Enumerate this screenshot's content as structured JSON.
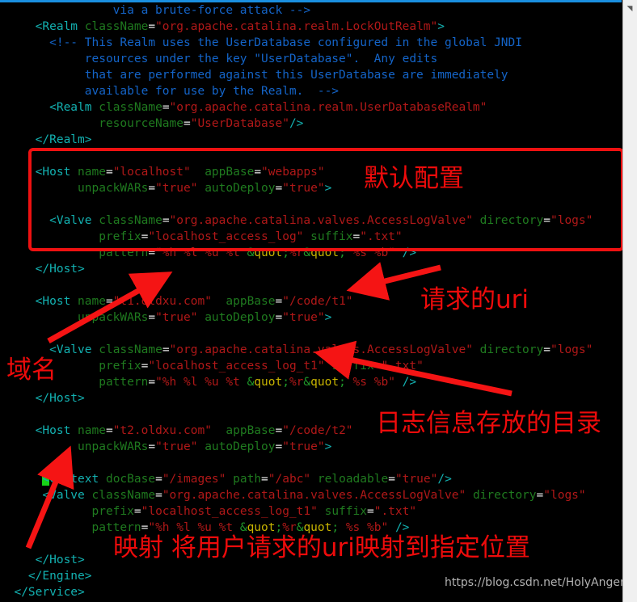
{
  "editor": {
    "background": "#000000",
    "topbar_color": "#1a8fe0",
    "colors": {
      "tag": "#13b1b1",
      "attribute": "#1f7a1f",
      "value": "#b01818",
      "comment": "#1464c8",
      "entity": "#c8b400",
      "cursor_highlight": "#17d417",
      "annotation_red": "#ee0b0b"
    },
    "scrollbar": {
      "up_arrow_glyph": "◥"
    }
  },
  "code_lines": [
    "                via a brute-force attack -->",
    "     <Realm className=\"org.apache.catalina.realm.LockOutRealm\">",
    "       <!-- This Realm uses the UserDatabase configured in the global JNDI",
    "            resources under the key \"UserDatabase\".  Any edits",
    "            that are performed against this UserDatabase are immediately",
    "            available for use by the Realm.  -->",
    "       <Realm className=\"org.apache.catalina.realm.UserDatabaseRealm\"",
    "              resourceName=\"UserDatabase\"/>",
    "     </Realm>",
    "",
    "     <Host name=\"localhost\"  appBase=\"webapps\"",
    "           unpackWARs=\"true\" autoDeploy=\"true\">",
    "",
    "       <Valve className=\"org.apache.catalina.valves.AccessLogValve\" directory=\"logs\"",
    "              prefix=\"localhost_access_log\" suffix=\".txt\"",
    "              pattern=\"%h %l %u %t &quot;%r&quot; %s %b\" />",
    "     </Host>",
    "",
    "     <Host name=\"t1.oldxu.com\"  appBase=\"/code/t1\"",
    "           unpackWARs=\"true\" autoDeploy=\"true\">",
    "",
    "       <Valve className=\"org.apache.catalina.valves.AccessLogValve\" directory=\"logs\"",
    "              prefix=\"localhost_access_log_t1\" suffix=\".txt\"",
    "              pattern=\"%h %l %u %t &quot;%r&quot; %s %b\" />",
    "     </Host>",
    "",
    "     <Host name=\"t2.oldxu.com\"  appBase=\"/code/t2\"",
    "           unpackWARs=\"true\" autoDeploy=\"true\">",
    "",
    "       <Context docBase=\"/images\" path=\"/abc\" reloadable=\"true\"/>",
    "       <Valve className=\"org.apache.catalina.valves.AccessLogValve\" directory=\"logs\"",
    "              prefix=\"localhost_access_log_t1\" suffix=\".txt\"",
    "              pattern=\"%h %l %u %t &quot;%r&quot; %s %b\" />",
    "",
    "     </Host>",
    "    </Engine>",
    "  </Service>"
  ],
  "annotations": {
    "default_config": "默认配置",
    "request_uri": "请求的uri",
    "domain_name": "域名",
    "log_directory": "日志信息存放的目录",
    "mapping": "映射 将用户请求的uri映射到指定位置"
  },
  "watermark": {
    "text": "https://blog.csdn.net/HolyAngemon"
  }
}
